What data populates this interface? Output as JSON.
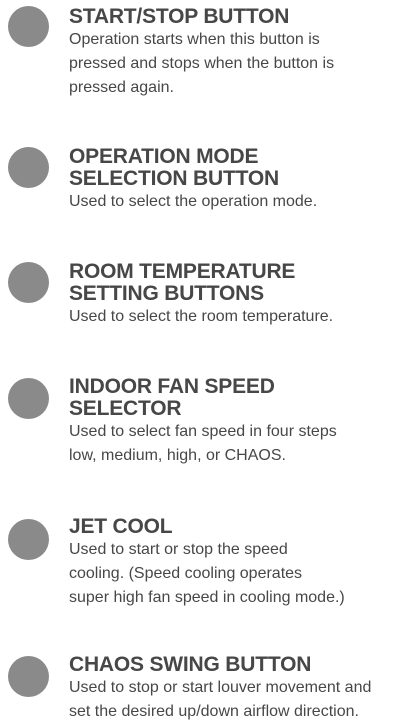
{
  "entries": [
    {
      "title_lines": [
        "START/STOP BUTTON"
      ],
      "desc_lines": [
        "Operation starts when this button is",
        "pressed and stops when the button is",
        "pressed again."
      ]
    },
    {
      "title_lines": [
        "OPERATION MODE",
        "SELECTION BUTTON"
      ],
      "desc_lines": [
        "Used to select the operation mode."
      ]
    },
    {
      "title_lines": [
        "ROOM TEMPERATURE",
        "SETTING BUTTONS"
      ],
      "desc_lines": [
        "Used to select the room temperature."
      ]
    },
    {
      "title_lines": [
        "INDOOR FAN SPEED",
        "SELECTOR"
      ],
      "desc_lines": [
        "Used to select fan speed in four steps",
        "low, medium, high, or CHAOS."
      ]
    },
    {
      "title_lines": [
        "JET COOL"
      ],
      "desc_lines": [
        "Used to start or stop the speed",
        "cooling. (Speed cooling operates",
        "super high fan speed in cooling mode.)"
      ]
    },
    {
      "title_lines": [
        "CHAOS SWING BUTTON"
      ],
      "desc_lines": [
        "Used to stop or start louver movement and",
        "set the desired up/down airflow direction."
      ]
    }
  ]
}
